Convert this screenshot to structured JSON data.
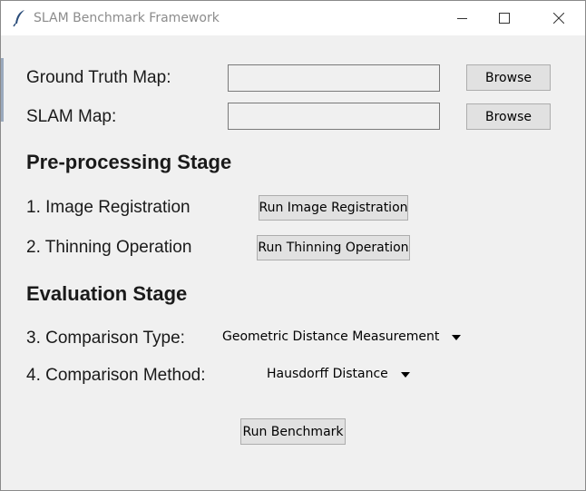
{
  "window": {
    "title": "SLAM Benchmark Framework"
  },
  "inputs": {
    "ground_truth_label": "Ground Truth Map:",
    "ground_truth_value": "",
    "slam_map_label": "SLAM Map:",
    "slam_map_value": "",
    "browse_label": "Browse"
  },
  "preprocessing": {
    "heading": "Pre-processing Stage",
    "step1_label": "1. Image Registration",
    "step1_button": "Run Image Registration",
    "step2_label": "2. Thinning Operation",
    "step2_button": "Run Thinning Operation"
  },
  "evaluation": {
    "heading": "Evaluation Stage",
    "step3_label": "3. Comparison Type:",
    "step3_selected": "Geometric Distance Measurement",
    "step4_label": "4. Comparison Method:",
    "step4_selected": "Hausdorff Distance"
  },
  "actions": {
    "run_benchmark": "Run Benchmark"
  },
  "icons": {
    "app": "feather-icon",
    "minimize": "minimize-icon",
    "maximize": "maximize-icon",
    "close": "close-icon",
    "dropdown": "dropdown-arrow-icon"
  }
}
